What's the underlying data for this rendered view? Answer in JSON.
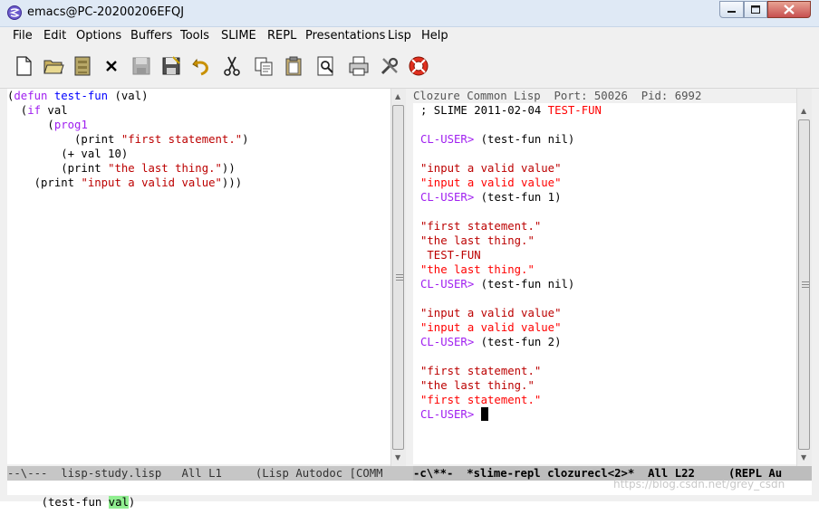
{
  "window": {
    "title": "emacs@PC-20200206EFQJ",
    "icon": "emacs-icon"
  },
  "menu": [
    "File",
    "Edit",
    "Options",
    "Buffers",
    "Tools",
    "SLIME",
    "REPL",
    "Presentations",
    "Lisp",
    "Help"
  ],
  "toolbar": [
    "new-file-icon",
    "open-folder-icon",
    "open-directory-icon",
    "close-icon",
    "save-icon",
    "save-as-icon",
    "undo-icon",
    "cut-icon",
    "copy-icon",
    "paste-icon",
    "search-icon",
    "print-icon",
    "preferences-icon",
    "help-icon"
  ],
  "left_buffer": {
    "lines": [
      [
        "(",
        "defun",
        " ",
        "test-fun",
        " (val)"
      ],
      [
        "  (if val"
      ],
      [
        "      (prog1"
      ],
      [
        "          (print \"first statement.\")"
      ],
      [
        "        (+ val 10)"
      ],
      [
        "        (print \"the last thing.\"))"
      ],
      [
        "    (print \"input a valid value\")))"
      ]
    ]
  },
  "right_buffer": {
    "header": "Clozure Common Lisp  Port: 50026  Pid: 6992",
    "banner_prefix": "; SLIME 2011-02-04 ",
    "banner_name": "TEST-FUN",
    "prompt": "CL-USER>",
    "cmd1": "(test-fun nil)",
    "out1a": "\"input a valid value\"",
    "out1b": "\"input a valid value\"",
    "cmd2": "(test-fun 1)",
    "out2a": "\"first statement.\"",
    "out2b": "\"the last thing.\"",
    "out2c": " TEST-FUN",
    "out2d": "\"the last thing.\"",
    "cmd3": "(test-fun nil)",
    "out3a": "\"input a valid value\"",
    "out3b": "\"input a valid value\"",
    "cmd4": "(test-fun 2)",
    "out4a": "\"first statement.\"",
    "out4b": "\"the last thing.\"",
    "out4c": "\"first statement.\""
  },
  "modeline": {
    "left": "--\\---  lisp-study.lisp   All L1     (Lisp Autodoc [COMM",
    "right": "-c\\**-  *slime-repl clozurecl<2>*  All L22     (REPL Au"
  },
  "minibuffer": {
    "before": "(test-fun ",
    "highlight": "val",
    "after": ")"
  },
  "watermark": "https://blog.csdn.net/grey_csdn"
}
